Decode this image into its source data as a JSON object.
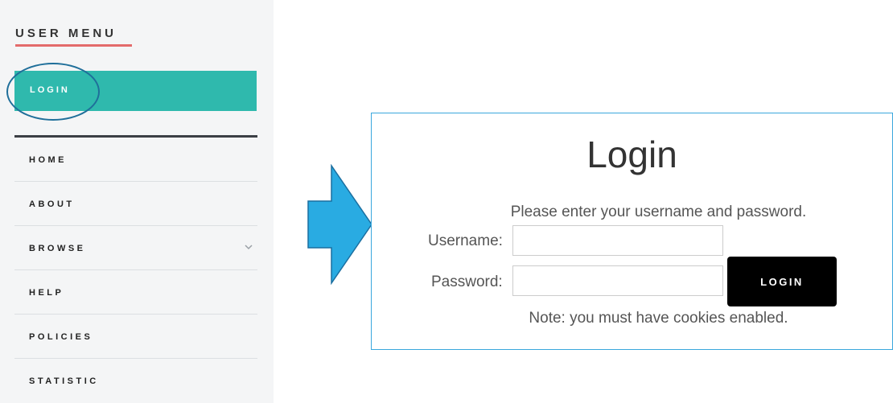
{
  "sidebar": {
    "title": "USER MENU",
    "active_item": {
      "label": "LOGIN"
    },
    "items": [
      {
        "label": "HOME"
      },
      {
        "label": "ABOUT"
      },
      {
        "label": "BROWSE",
        "has_submenu": true
      },
      {
        "label": "HELP"
      },
      {
        "label": "POLICIES"
      },
      {
        "label": "STATISTIC"
      }
    ],
    "colors": {
      "background": "#f4f5f6",
      "active": "#2fb9ad",
      "title_underline": "#e36b6b",
      "highlight_ring": "#1f6f9a"
    },
    "icons": {
      "browse_chevron": "chevron-down-icon"
    }
  },
  "arrow": {
    "icon": "right-arrow-icon",
    "color": "#29abe2"
  },
  "login_panel": {
    "title": "Login",
    "instructions": "Please enter your username and password.",
    "username_label": "Username:",
    "username_value": "",
    "password_label": "Password:",
    "password_value": "",
    "submit_label": "LOGIN",
    "note": "Note: you must have cookies enabled.",
    "colors": {
      "border": "#3aa7dd",
      "button": "#000000"
    }
  }
}
